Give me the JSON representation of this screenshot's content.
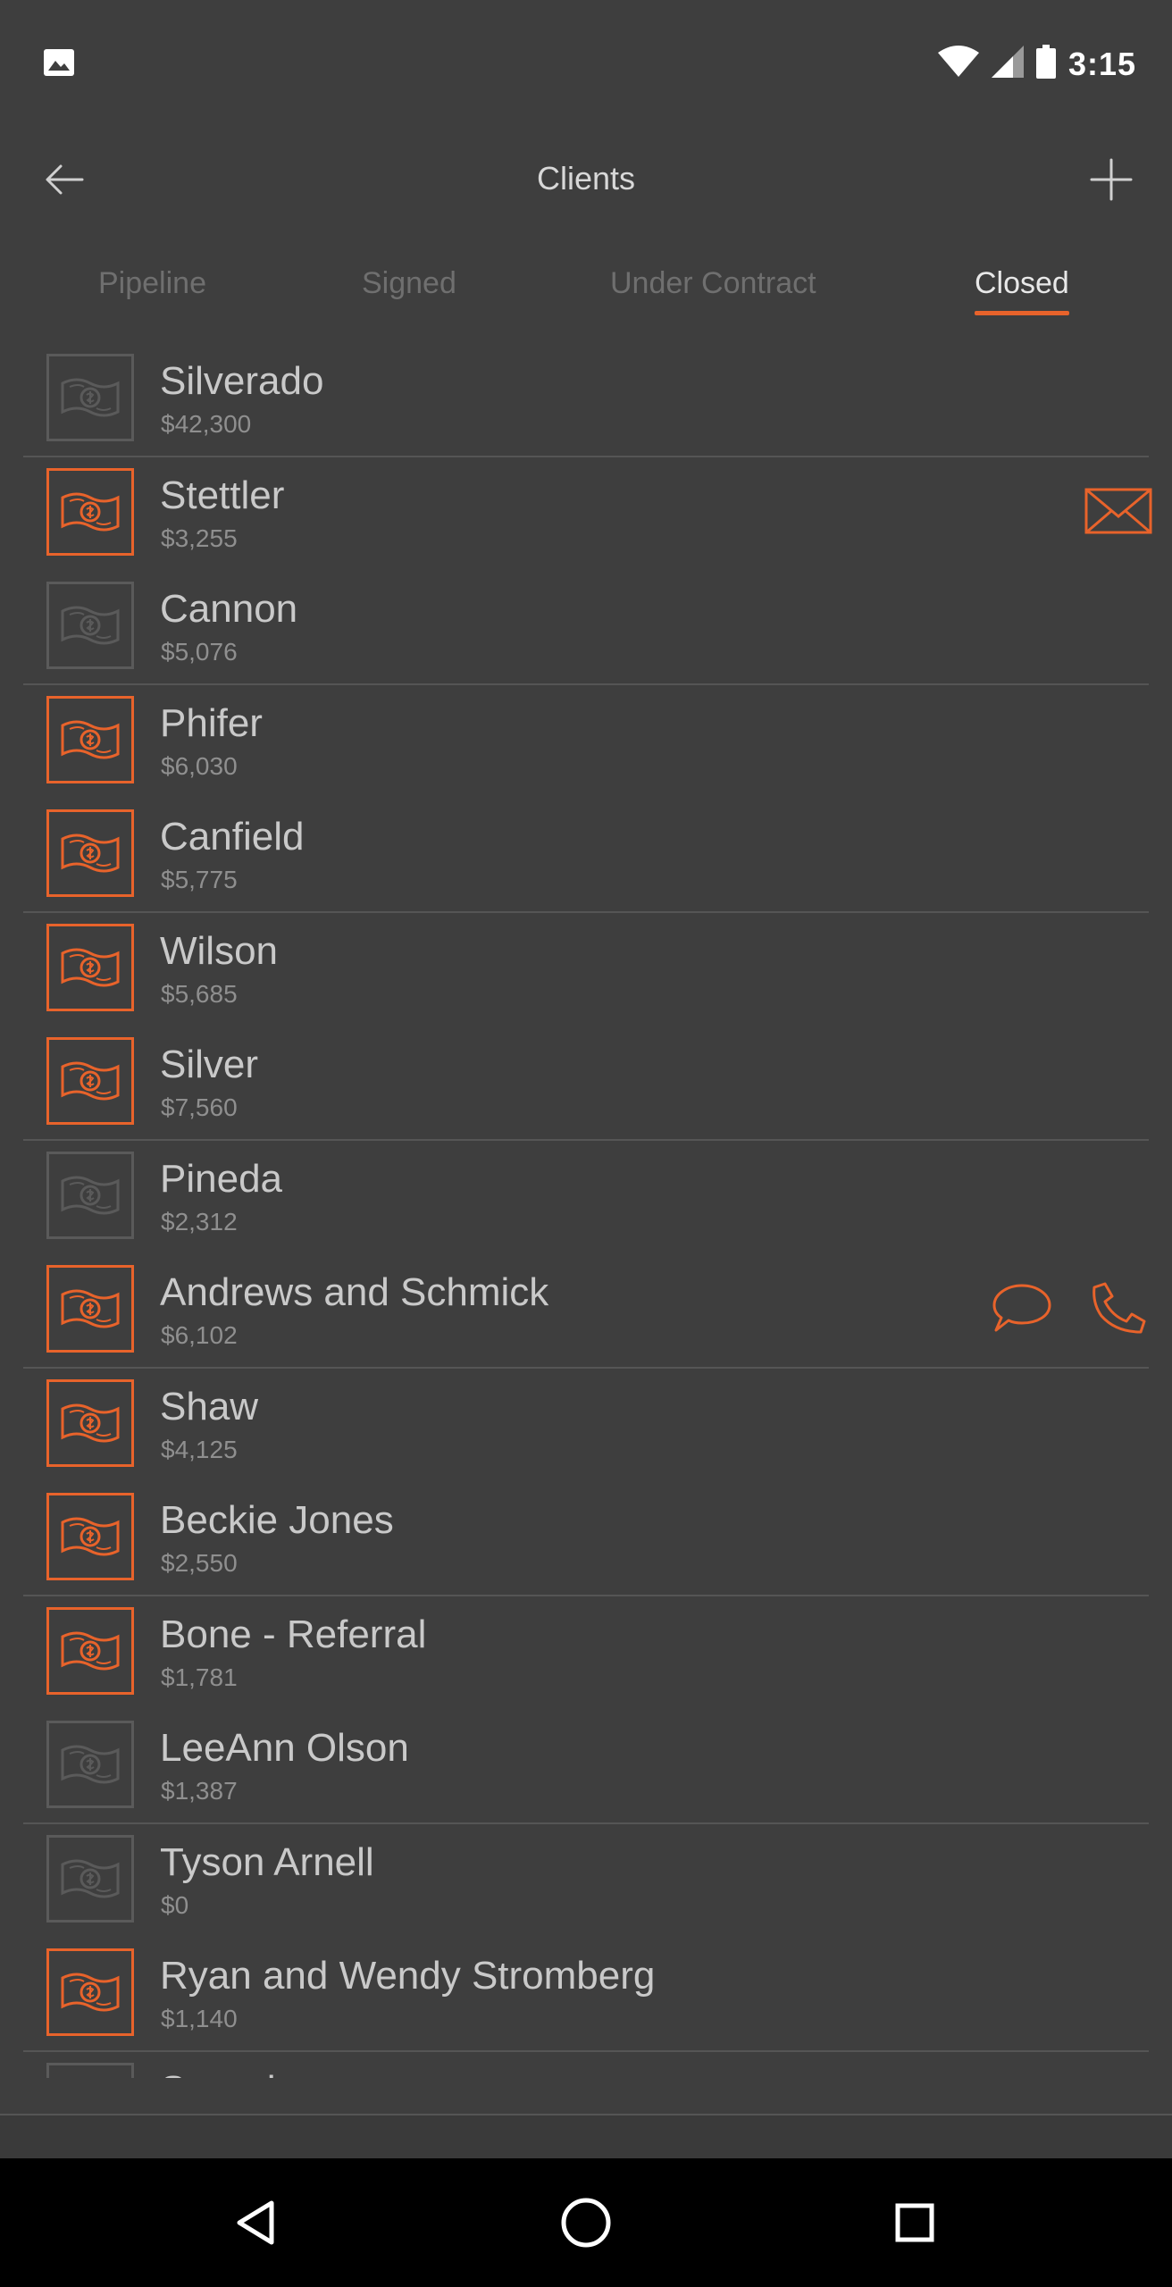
{
  "status_bar": {
    "time": "3:15",
    "icons": [
      "gallery-icon",
      "wifi-icon",
      "signal-icon",
      "battery-icon"
    ]
  },
  "header": {
    "title": "Clients",
    "back_icon": "arrow-left-icon",
    "add_icon": "plus-icon"
  },
  "tabs": [
    {
      "label": "Pipeline",
      "active": false
    },
    {
      "label": "Signed",
      "active": false
    },
    {
      "label": "Under Contract",
      "active": false
    },
    {
      "label": "Closed",
      "active": true
    }
  ],
  "colors": {
    "accent": "#e8632b",
    "background": "#3e3e3e",
    "inactive_icon": "#5a5a5a"
  },
  "clients": [
    {
      "name": "Silverado",
      "amount": "$42,300",
      "active": false,
      "actions": []
    },
    {
      "name": "Stettler",
      "amount": "$3,255",
      "active": true,
      "actions": [
        "envelope-icon"
      ]
    },
    {
      "name": "Cannon",
      "amount": "$5,076",
      "active": false,
      "actions": []
    },
    {
      "name": "Phifer",
      "amount": "$6,030",
      "active": true,
      "actions": []
    },
    {
      "name": "Canfield",
      "amount": "$5,775",
      "active": true,
      "actions": []
    },
    {
      "name": "Wilson",
      "amount": "$5,685",
      "active": true,
      "actions": []
    },
    {
      "name": "Silver",
      "amount": "$7,560",
      "active": true,
      "actions": []
    },
    {
      "name": "Pineda",
      "amount": "$2,312",
      "active": false,
      "actions": []
    },
    {
      "name": "Andrews and Schmick",
      "amount": "$6,102",
      "active": true,
      "actions": [
        "chat-bubble-icon",
        "phone-icon"
      ]
    },
    {
      "name": "Shaw",
      "amount": "$4,125",
      "active": true,
      "actions": []
    },
    {
      "name": "Beckie Jones",
      "amount": "$2,550",
      "active": true,
      "actions": []
    },
    {
      "name": "Bone - Referral",
      "amount": "$1,781",
      "active": true,
      "actions": []
    },
    {
      "name": "LeeAnn Olson",
      "amount": "$1,387",
      "active": false,
      "actions": []
    },
    {
      "name": "Tyson Arnell",
      "amount": "$0",
      "active": false,
      "actions": []
    },
    {
      "name": "Ryan and Wendy Stromberg",
      "amount": "$1,140",
      "active": true,
      "actions": []
    },
    {
      "name": "Stroud",
      "amount": "",
      "active": false,
      "actions": []
    }
  ],
  "nav_bar": {
    "buttons": [
      "back-triangle-icon",
      "home-circle-icon",
      "recents-square-icon"
    ]
  }
}
